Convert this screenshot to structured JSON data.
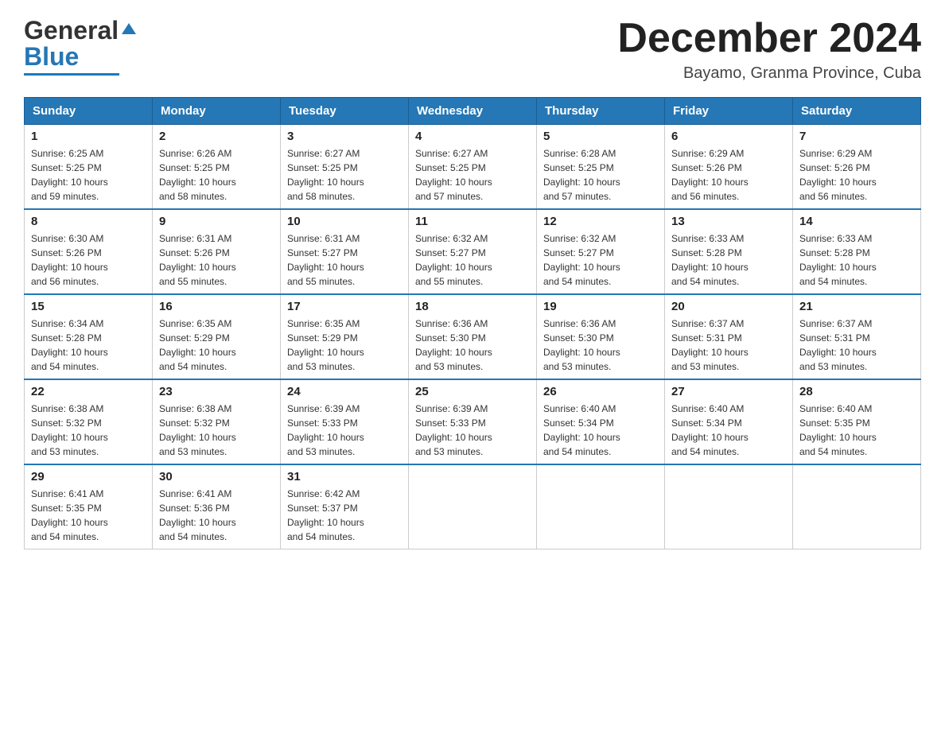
{
  "header": {
    "logo": {
      "text_general": "General",
      "text_blue": "Blue"
    },
    "title": "December 2024",
    "subtitle": "Bayamo, Granma Province, Cuba"
  },
  "days_of_week": [
    "Sunday",
    "Monday",
    "Tuesday",
    "Wednesday",
    "Thursday",
    "Friday",
    "Saturday"
  ],
  "weeks": [
    [
      {
        "day": "1",
        "sunrise": "6:25 AM",
        "sunset": "5:25 PM",
        "daylight": "10 hours and 59 minutes."
      },
      {
        "day": "2",
        "sunrise": "6:26 AM",
        "sunset": "5:25 PM",
        "daylight": "10 hours and 58 minutes."
      },
      {
        "day": "3",
        "sunrise": "6:27 AM",
        "sunset": "5:25 PM",
        "daylight": "10 hours and 58 minutes."
      },
      {
        "day": "4",
        "sunrise": "6:27 AM",
        "sunset": "5:25 PM",
        "daylight": "10 hours and 57 minutes."
      },
      {
        "day": "5",
        "sunrise": "6:28 AM",
        "sunset": "5:25 PM",
        "daylight": "10 hours and 57 minutes."
      },
      {
        "day": "6",
        "sunrise": "6:29 AM",
        "sunset": "5:26 PM",
        "daylight": "10 hours and 56 minutes."
      },
      {
        "day": "7",
        "sunrise": "6:29 AM",
        "sunset": "5:26 PM",
        "daylight": "10 hours and 56 minutes."
      }
    ],
    [
      {
        "day": "8",
        "sunrise": "6:30 AM",
        "sunset": "5:26 PM",
        "daylight": "10 hours and 56 minutes."
      },
      {
        "day": "9",
        "sunrise": "6:31 AM",
        "sunset": "5:26 PM",
        "daylight": "10 hours and 55 minutes."
      },
      {
        "day": "10",
        "sunrise": "6:31 AM",
        "sunset": "5:27 PM",
        "daylight": "10 hours and 55 minutes."
      },
      {
        "day": "11",
        "sunrise": "6:32 AM",
        "sunset": "5:27 PM",
        "daylight": "10 hours and 55 minutes."
      },
      {
        "day": "12",
        "sunrise": "6:32 AM",
        "sunset": "5:27 PM",
        "daylight": "10 hours and 54 minutes."
      },
      {
        "day": "13",
        "sunrise": "6:33 AM",
        "sunset": "5:28 PM",
        "daylight": "10 hours and 54 minutes."
      },
      {
        "day": "14",
        "sunrise": "6:33 AM",
        "sunset": "5:28 PM",
        "daylight": "10 hours and 54 minutes."
      }
    ],
    [
      {
        "day": "15",
        "sunrise": "6:34 AM",
        "sunset": "5:28 PM",
        "daylight": "10 hours and 54 minutes."
      },
      {
        "day": "16",
        "sunrise": "6:35 AM",
        "sunset": "5:29 PM",
        "daylight": "10 hours and 54 minutes."
      },
      {
        "day": "17",
        "sunrise": "6:35 AM",
        "sunset": "5:29 PM",
        "daylight": "10 hours and 53 minutes."
      },
      {
        "day": "18",
        "sunrise": "6:36 AM",
        "sunset": "5:30 PM",
        "daylight": "10 hours and 53 minutes."
      },
      {
        "day": "19",
        "sunrise": "6:36 AM",
        "sunset": "5:30 PM",
        "daylight": "10 hours and 53 minutes."
      },
      {
        "day": "20",
        "sunrise": "6:37 AM",
        "sunset": "5:31 PM",
        "daylight": "10 hours and 53 minutes."
      },
      {
        "day": "21",
        "sunrise": "6:37 AM",
        "sunset": "5:31 PM",
        "daylight": "10 hours and 53 minutes."
      }
    ],
    [
      {
        "day": "22",
        "sunrise": "6:38 AM",
        "sunset": "5:32 PM",
        "daylight": "10 hours and 53 minutes."
      },
      {
        "day": "23",
        "sunrise": "6:38 AM",
        "sunset": "5:32 PM",
        "daylight": "10 hours and 53 minutes."
      },
      {
        "day": "24",
        "sunrise": "6:39 AM",
        "sunset": "5:33 PM",
        "daylight": "10 hours and 53 minutes."
      },
      {
        "day": "25",
        "sunrise": "6:39 AM",
        "sunset": "5:33 PM",
        "daylight": "10 hours and 53 minutes."
      },
      {
        "day": "26",
        "sunrise": "6:40 AM",
        "sunset": "5:34 PM",
        "daylight": "10 hours and 54 minutes."
      },
      {
        "day": "27",
        "sunrise": "6:40 AM",
        "sunset": "5:34 PM",
        "daylight": "10 hours and 54 minutes."
      },
      {
        "day": "28",
        "sunrise": "6:40 AM",
        "sunset": "5:35 PM",
        "daylight": "10 hours and 54 minutes."
      }
    ],
    [
      {
        "day": "29",
        "sunrise": "6:41 AM",
        "sunset": "5:35 PM",
        "daylight": "10 hours and 54 minutes."
      },
      {
        "day": "30",
        "sunrise": "6:41 AM",
        "sunset": "5:36 PM",
        "daylight": "10 hours and 54 minutes."
      },
      {
        "day": "31",
        "sunrise": "6:42 AM",
        "sunset": "5:37 PM",
        "daylight": "10 hours and 54 minutes."
      },
      null,
      null,
      null,
      null
    ]
  ],
  "labels": {
    "sunrise": "Sunrise:",
    "sunset": "Sunset:",
    "daylight": "Daylight:"
  }
}
